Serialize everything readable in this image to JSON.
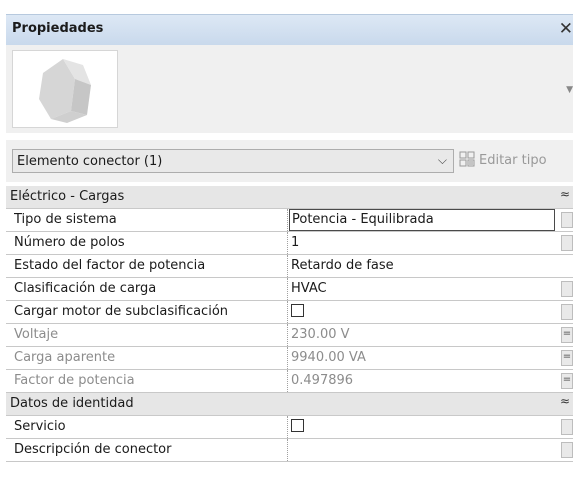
{
  "panel": {
    "title": "Propiedades",
    "close_icon": "close-icon"
  },
  "type_selector": {
    "value": "Elemento conector (1)",
    "edit_type_label": "Editar tipo"
  },
  "categories": [
    {
      "label": "Eléctrico - Cargas",
      "rows": [
        {
          "name": "Tipo de sistema",
          "value": "Potencia - Equilibrada",
          "editing": true
        },
        {
          "name": "Número de polos",
          "value": "1"
        },
        {
          "name": "Estado del factor de potencia",
          "value": "Retardo de fase"
        },
        {
          "name": "Clasificación de carga",
          "value": "HVAC"
        },
        {
          "name": "Cargar motor de subclasificación",
          "value": "",
          "checkbox": true,
          "checked": false
        },
        {
          "name": "Voltaje",
          "value": "230.00 V",
          "disabled": true
        },
        {
          "name": "Carga aparente",
          "value": "9940.00 VA",
          "disabled": true
        },
        {
          "name": "Factor de potencia",
          "value": "0.497896",
          "disabled": true
        }
      ]
    },
    {
      "label": "Datos de identidad",
      "rows": [
        {
          "name": "Servicio",
          "value": "",
          "checkbox": true,
          "checked": false
        },
        {
          "name": "Descripción de conector",
          "value": ""
        }
      ]
    }
  ]
}
